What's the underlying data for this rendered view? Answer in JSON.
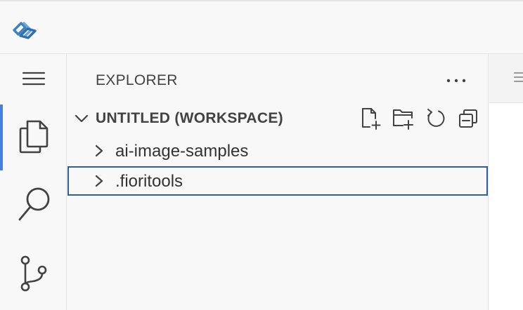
{
  "titlebar": {
    "logo_icon": "sap-business-application-studio-logo"
  },
  "activity_bar": {
    "items": [
      {
        "id": "menu",
        "icon": "hamburger-menu-icon",
        "active": false
      },
      {
        "id": "explorer",
        "icon": "files-icon",
        "active": true
      },
      {
        "id": "search",
        "icon": "search-icon",
        "active": false
      },
      {
        "id": "source-control",
        "icon": "source-control-icon",
        "active": false
      }
    ]
  },
  "sidebar": {
    "title": "EXPLORER",
    "more_actions_icon": "ellipsis-icon",
    "workspace": {
      "title": "UNTITLED (WORKSPACE)",
      "expanded": true,
      "actions": [
        {
          "icon": "new-file-icon"
        },
        {
          "icon": "new-folder-icon"
        },
        {
          "icon": "refresh-icon"
        },
        {
          "icon": "collapse-all-icon"
        }
      ],
      "items": [
        {
          "label": "ai-image-samples",
          "expanded": false,
          "focused": false
        },
        {
          "label": ".fioritools",
          "expanded": false,
          "focused": true
        }
      ]
    }
  },
  "colors": {
    "accent": "#4a7ee0",
    "focus_border": "#2d5ea8",
    "logo_primary": "#3b82c4",
    "logo_secondary": "#6aa8dc"
  }
}
